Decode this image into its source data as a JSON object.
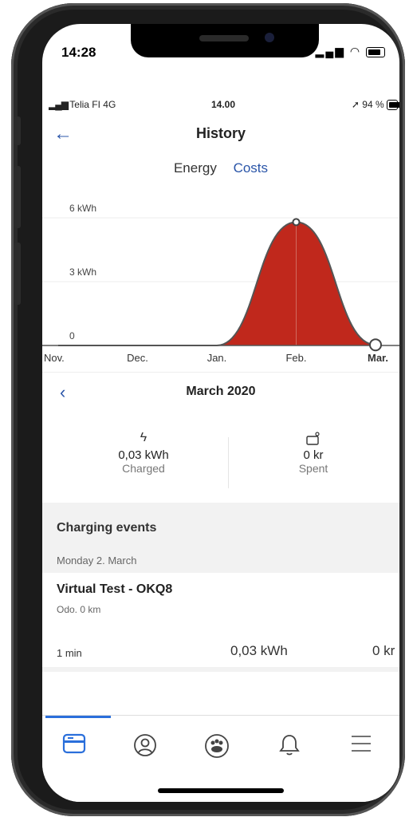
{
  "ios_status": {
    "time": "14:28"
  },
  "app_status": {
    "carrier": "Telia FI  4G",
    "time": "14.00",
    "battery": "94 %"
  },
  "header": {
    "title": "History"
  },
  "tabs": [
    {
      "label": "Energy",
      "active": false
    },
    {
      "label": "Costs",
      "active": true
    }
  ],
  "chart_data": {
    "type": "area",
    "categories": [
      "Nov.",
      "Dec.",
      "Jan.",
      "Feb.",
      "Mar."
    ],
    "values": [
      0,
      0,
      0,
      5.8,
      0.03
    ],
    "y_ticks": [
      "6 kWh",
      "3 kWh",
      "0"
    ],
    "ylim": [
      0,
      6
    ],
    "fill_color": "#c0281c",
    "line_color": "#555555",
    "grid": true
  },
  "month": {
    "title": "March 2020"
  },
  "stats": {
    "charged": {
      "value": "0,03 kWh",
      "label": "Charged"
    },
    "spent": {
      "value": "0 kr",
      "label": "Spent"
    }
  },
  "events": {
    "header": "Charging events",
    "date": "Monday 2. March",
    "items": [
      {
        "name": "Virtual Test - OKQ8",
        "odo": "Odo. 0 km",
        "duration": "1 min",
        "energy": "0,03 kWh",
        "cost": "0 kr"
      }
    ]
  },
  "tabbar": {
    "items": [
      "card-icon",
      "profile-icon",
      "community-icon",
      "bell-icon",
      "menu-icon"
    ],
    "accent": "#2a6fdb"
  }
}
